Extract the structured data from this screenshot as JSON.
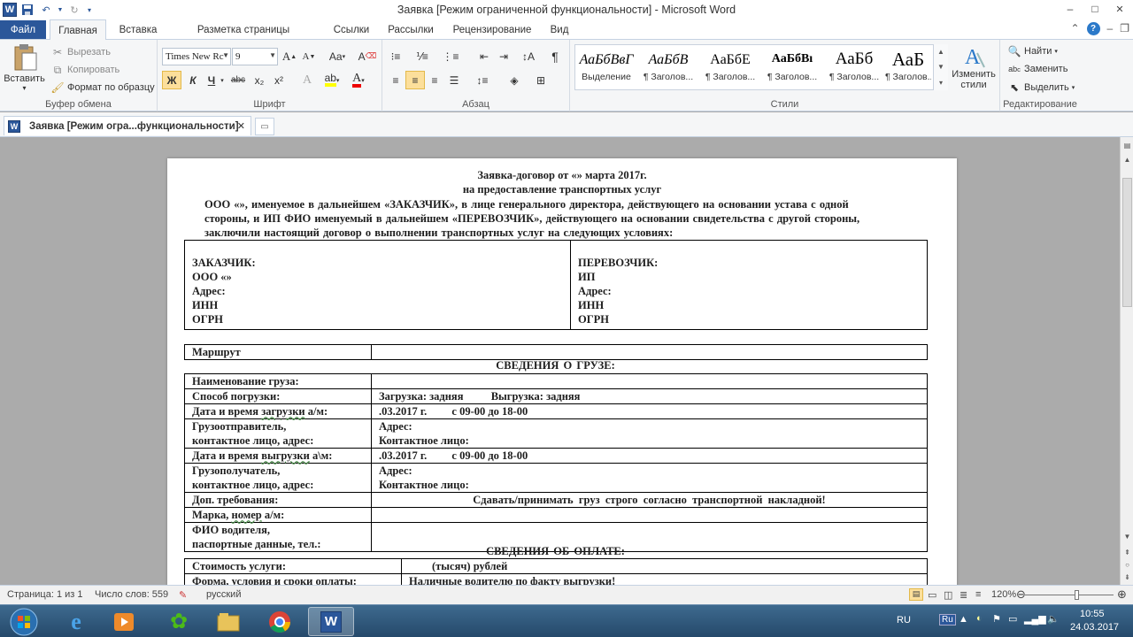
{
  "window": {
    "title": "Заявка [Режим ограниченной функциональности]  -  Microsoft Word",
    "app_icon": "W",
    "minimize": "–",
    "maximize": "□",
    "close": "✕"
  },
  "tabs": [
    "Файл",
    "Главная",
    "Вставка",
    "Разметка страницы",
    "Ссылки",
    "Рассылки",
    "Рецензирование",
    "Вид"
  ],
  "ribbon": {
    "clipboard": {
      "label": "Буфер обмена",
      "paste": "Вставить",
      "cut": "Вырезать",
      "copy": "Копировать",
      "format_painter": "Формат по образцу"
    },
    "font": {
      "label": "Шрифт",
      "family": "Times New Rc",
      "size": "9",
      "bold": "Ж",
      "italic": "К",
      "underline": "Ч",
      "strike": "abc",
      "sub": "x₂",
      "sup": "x²",
      "case": "Aa"
    },
    "paragraph": {
      "label": "Абзац"
    },
    "styles": {
      "label": "Стили",
      "items": [
        {
          "preview": "АаБбВвГ",
          "name": "Выделение"
        },
        {
          "preview": "АаБбВ",
          "name": "¶ Заголов..."
        },
        {
          "preview": "АаБбЕ",
          "name": "¶ Заголов..."
        },
        {
          "preview": "АаБбВı",
          "name": "¶ Заголов..."
        },
        {
          "preview": "АаБб",
          "name": "¶ Заголов..."
        },
        {
          "preview": "АаБ",
          "name": "¶ Заголов..."
        }
      ],
      "change": "Изменить стили"
    },
    "editing": {
      "label": "Редактирование",
      "find": "Найти",
      "replace": "Заменить",
      "select": "Выделить"
    }
  },
  "doc_tab": {
    "title": "Заявка [Режим огра...функциональности]",
    "close": "✕"
  },
  "document": {
    "title1": "Заявка-договор  от  «»  марта 2017г.",
    "title2": "на предоставление  транспортных  услуг",
    "intro1": "ООО «», именуемое в дальнейшем  «ЗАКАЗЧИК»,  в  лице генерального  директора, действующего  на основании устава с одной",
    "intro2": "стороны, и ИП ФИО именуемый в дальнейшем  «ПЕРЕВОЗЧИК»,  действующего  на основании  свидетельства  с другой стороны,",
    "intro3": "заключили настоящий  договор о выполнении транспортных услуг  на следующих  условиях:",
    "customer": {
      "h": "ЗАКАЗЧИК:",
      "org": "ООО «»",
      "addr": "Адрес:",
      "inn": "ИНН",
      "ogrn": "ОГРН"
    },
    "carrier": {
      "h": "ПЕРЕВОЗЧИК:",
      "org": "ИП",
      "addr": "Адрес:",
      "inn": "ИНН",
      "ogrn": "ОГРН"
    },
    "route": "Маршрут",
    "cargo_head": "СВЕДЕНИЯ  О ГРУЗЕ:",
    "rows": {
      "name": "Наименование груза:",
      "loading": "Способ погрузки:",
      "loading_val": "Загрузка: задняя          Выгрузка: задняя",
      "load_dt_a": "Дата и время ",
      "load_dt_u": "загрузки",
      "load_dt_b": " а/м:",
      "load_dt_val": ".03.2017 г.         с 09-00 до 18-00",
      "shipper1": "Грузоотправитель,",
      "shipper2": "контактное лицо, адрес:",
      "addr": "Адрес:",
      "contact": "Контактное лицо:",
      "unload_dt_a": "Дата и время ",
      "unload_dt_u": "выгрузки",
      "unload_dt_b": " а\\м:",
      "unload_dt_val": ".03.2017 г.         с 09-00 до 18-00",
      "consignee1": "Грузополучатель,",
      "consignee2": "контактное лицо, адрес:",
      "extra": "Доп. требования:",
      "extra_val": "Сдавать/принимать  груз  строго  согласно  транспортной  накладной!",
      "car_a": "Марка, ",
      "car_u": "номер",
      "car_b": " а/м:",
      "driver1": "ФИО водителя,",
      "driver2": "паспортные данные,  тел.:"
    },
    "pay_head": "СВЕДЕНИЯ  ОБ  ОПЛАТЕ:",
    "pay": {
      "cost": "Стоимость услуги:",
      "cost_val": "(тысяч) рублей",
      "terms": "Форма, условия  и сроки оплаты:",
      "terms_val": "Наличные водителю по факту выгрузки!"
    }
  },
  "status": {
    "page": "Страница: 1 из 1",
    "words": "Число слов: 559",
    "lang": "русский",
    "zoom": "120%"
  },
  "tray": {
    "lang": "RU",
    "kb": "Ru",
    "time": "10:55",
    "date": "24.03.2017"
  }
}
